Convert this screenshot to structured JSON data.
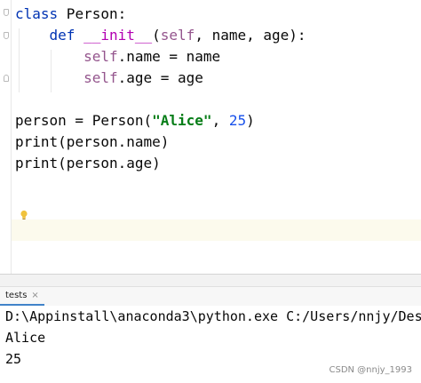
{
  "editor": {
    "lines": [
      {
        "tokens": [
          {
            "t": "class",
            "c": "kw"
          },
          {
            "t": " Person:",
            "c": ""
          }
        ]
      },
      {
        "tokens": [
          {
            "t": "    ",
            "c": ""
          },
          {
            "t": "def",
            "c": "kw"
          },
          {
            "t": " ",
            "c": ""
          },
          {
            "t": "__init__",
            "c": "dunder"
          },
          {
            "t": "(",
            "c": ""
          },
          {
            "t": "self",
            "c": "self"
          },
          {
            "t": ", name, age):",
            "c": ""
          }
        ]
      },
      {
        "tokens": [
          {
            "t": "        ",
            "c": ""
          },
          {
            "t": "self",
            "c": "self"
          },
          {
            "t": ".name = name",
            "c": ""
          }
        ]
      },
      {
        "tokens": [
          {
            "t": "        ",
            "c": ""
          },
          {
            "t": "self",
            "c": "self"
          },
          {
            "t": ".age = age",
            "c": ""
          }
        ]
      },
      {
        "tokens": []
      },
      {
        "tokens": [
          {
            "t": "person = Person(",
            "c": ""
          },
          {
            "t": "\"Alice\"",
            "c": "str"
          },
          {
            "t": ", ",
            "c": ""
          },
          {
            "t": "25",
            "c": "num"
          },
          {
            "t": ")",
            "c": ""
          }
        ]
      },
      {
        "tokens": [
          {
            "t": "print",
            "c": ""
          },
          {
            "t": "(person.name)",
            "c": ""
          }
        ]
      },
      {
        "tokens": [
          {
            "t": "print",
            "c": ""
          },
          {
            "t": "(person.age)",
            "c": ""
          }
        ]
      }
    ],
    "current_line_highlight": "#fcfaed",
    "bulb_icon": "lightbulb-icon"
  },
  "run_panel": {
    "tab_label": "tests",
    "close_glyph": "×"
  },
  "console": {
    "lines": [
      "D:\\Appinstall\\anaconda3\\python.exe C:/Users/nnjy/Des",
      "Alice",
      "25"
    ]
  },
  "watermark": "CSDN @nnjy_1993",
  "colors": {
    "keyword": "#0033b3",
    "self": "#94558d",
    "string": "#067d17",
    "number": "#1750eb",
    "dunder": "#b200b2",
    "tab_underline": "#4083c9"
  }
}
